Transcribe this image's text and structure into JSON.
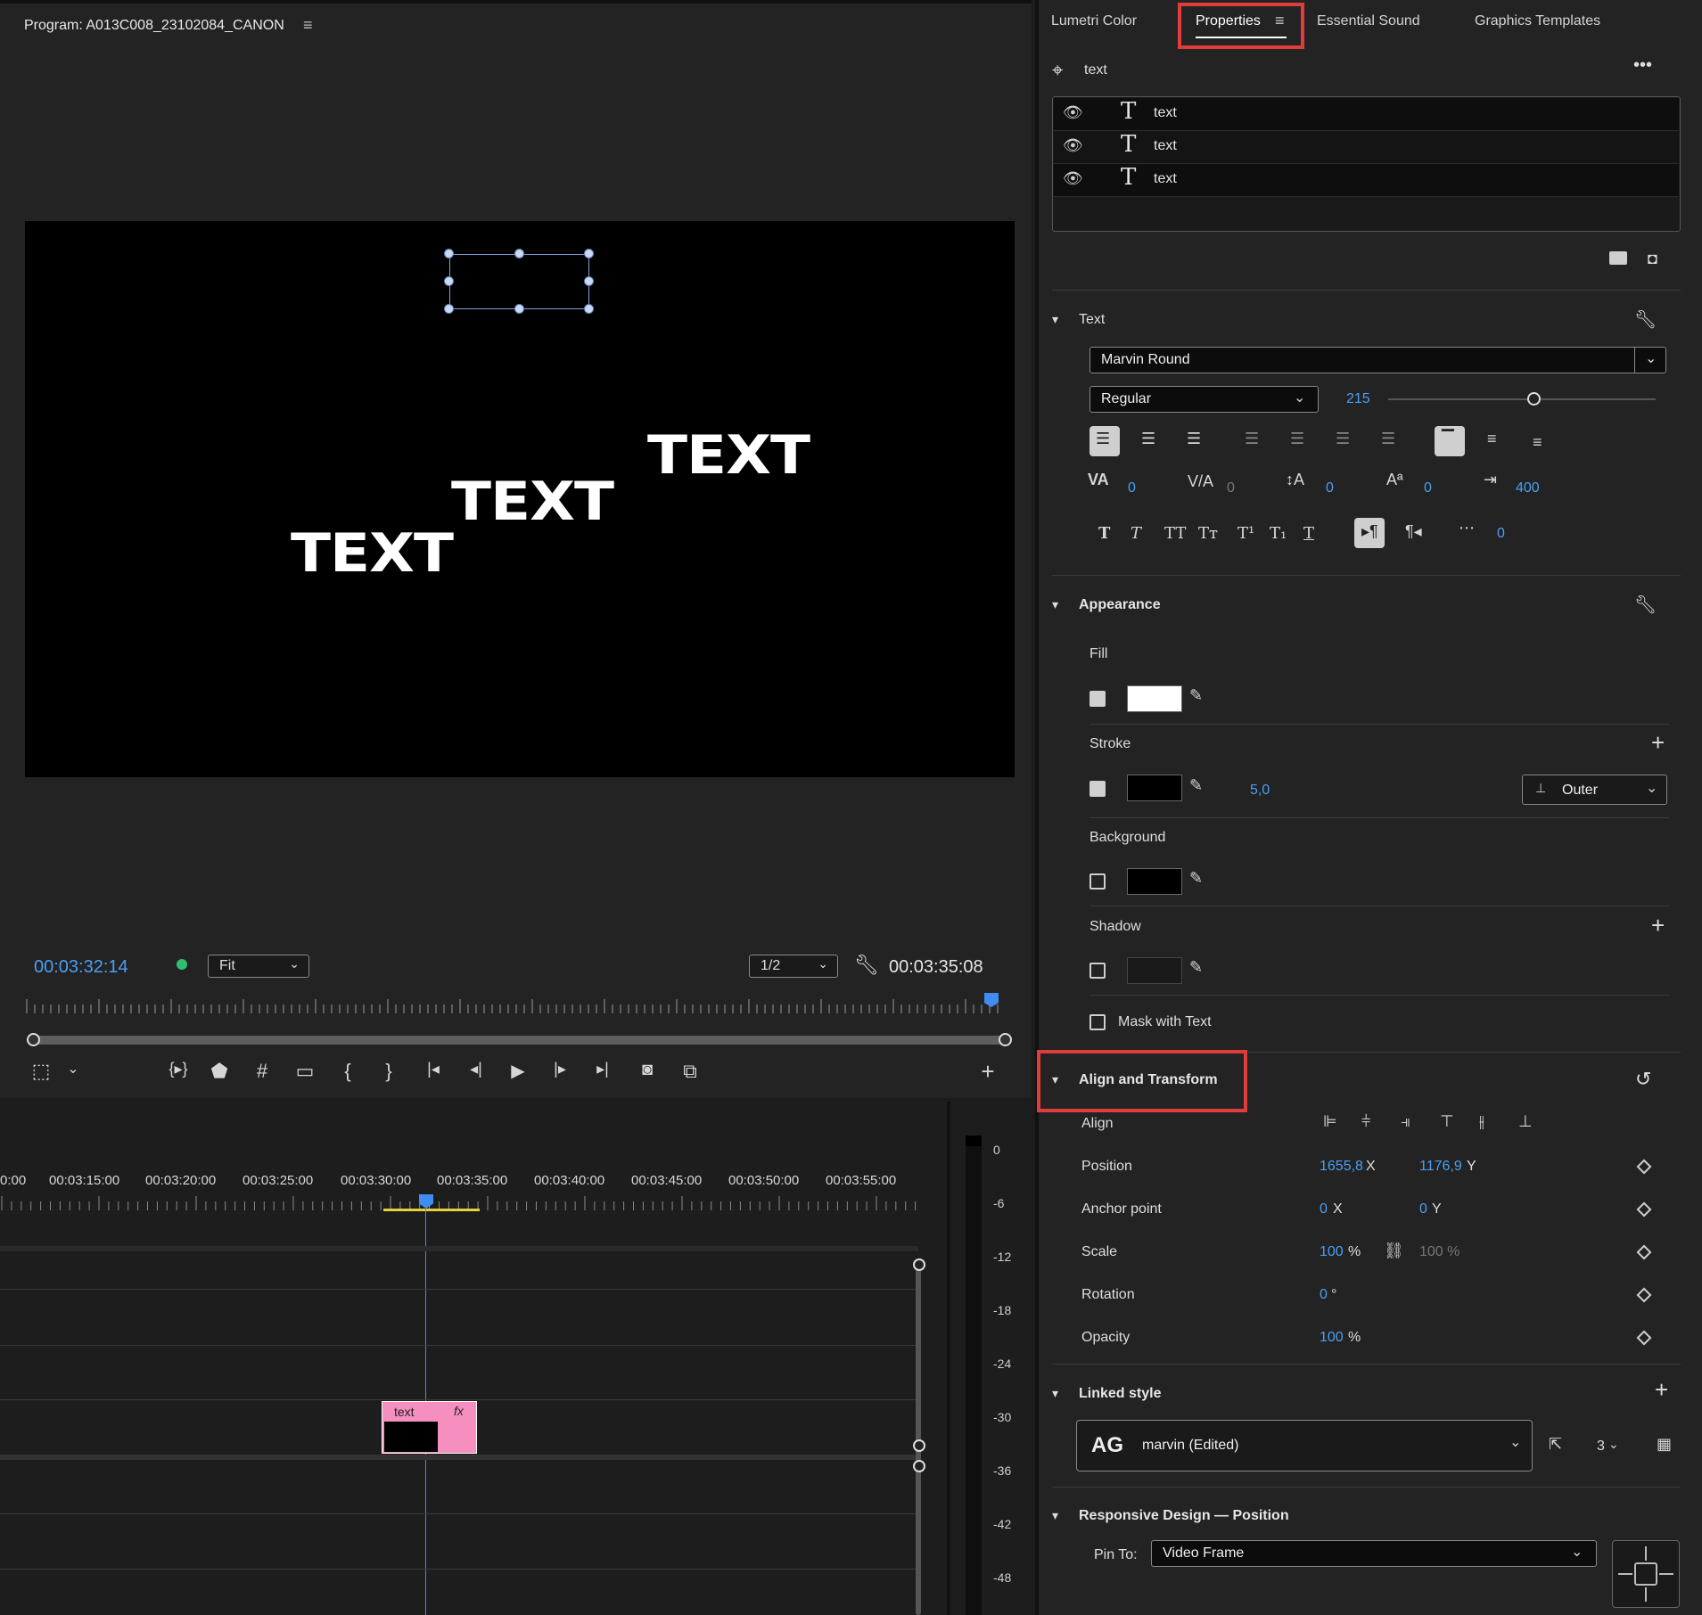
{
  "program": {
    "title": "Program: A013C008_23102084_CANON",
    "menu_icon": "hamburger-menu-icon",
    "canvas_texts": [
      "TEXT",
      "TEXT",
      "TEXT"
    ],
    "current_timecode": "00:03:32:14",
    "fit_value": "Fit",
    "resolution_value": "1/2",
    "duration_timecode": "00:03:35:08"
  },
  "timeline": {
    "times": [
      "0:00",
      "00:03:15:00",
      "00:03:20:00",
      "00:03:25:00",
      "00:03:30:00",
      "00:03:35:00",
      "00:03:40:00",
      "00:03:45:00",
      "00:03:50:00",
      "00:03:55:00"
    ],
    "clip_label": "text",
    "clip_fx": "fx"
  },
  "meter": {
    "labels": [
      "0",
      "-6",
      "-12",
      "-18",
      "-24",
      "-30",
      "-36",
      "-42",
      "-48"
    ]
  },
  "tabs": [
    "Lumetri Color",
    "Properties",
    "Essential Sound",
    "Graphics Templates"
  ],
  "properties": {
    "header": "text",
    "layers": [
      "text",
      "text",
      "text"
    ],
    "text_section": {
      "title": "Text",
      "font": "Marvin Round",
      "style": "Regular",
      "size": "215",
      "kerning": "0",
      "tracking": "0",
      "leading": "0",
      "baseline": "0",
      "tab_width": "400",
      "tsume": "0"
    },
    "appearance": {
      "title": "Appearance",
      "fill_label": "Fill",
      "stroke_label": "Stroke",
      "stroke_width": "5,0",
      "stroke_type": "Outer",
      "background_label": "Background",
      "shadow_label": "Shadow",
      "mask_label": "Mask with Text",
      "fill_color": "#ffffff",
      "stroke_color": "#000000"
    },
    "align_transform": {
      "title": "Align and Transform",
      "align_label": "Align",
      "position_label": "Position",
      "position_x": "1655,8",
      "position_y": "1176,9",
      "anchor_label": "Anchor point",
      "anchor_x": "0",
      "anchor_y": "0",
      "scale_label": "Scale",
      "scale_value": "100",
      "scale_value2": "100 %",
      "rotation_label": "Rotation",
      "rotation_value": "0",
      "opacity_label": "Opacity",
      "opacity_value": "100",
      "x_suffix": "X",
      "y_suffix": "Y",
      "pct": "%",
      "deg": "°"
    },
    "linked_style": {
      "title": "Linked style",
      "ag_text": "AG",
      "style_name": "marvin (Edited)",
      "count": "3"
    },
    "responsive": {
      "title": "Responsive Design — Position",
      "pin_label": "Pin To:",
      "pin_value": "Video Frame"
    }
  },
  "colors": {
    "accent_blue": "#4a9ff5",
    "highlight_red": "#e03c3c",
    "clip_pink": "#f48fc0",
    "playhead_blue": "#3f8cf2"
  }
}
